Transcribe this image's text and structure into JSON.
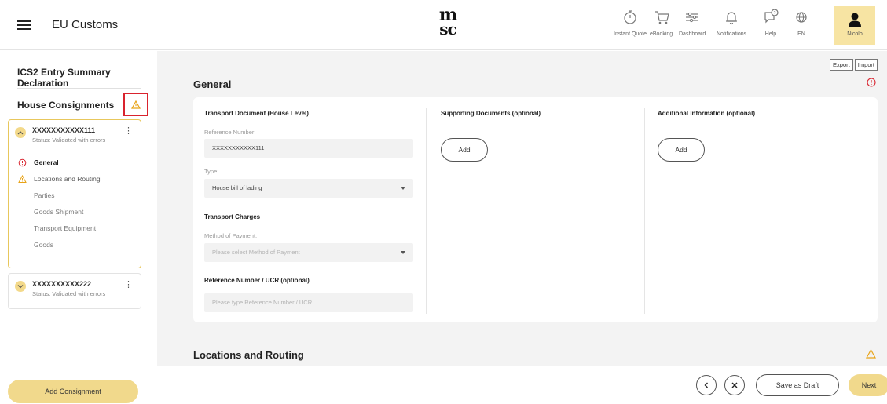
{
  "header": {
    "app_title": "EU Customs",
    "logo_line1": "m",
    "logo_line2": "sc",
    "nav": [
      {
        "label": "Instant Quote",
        "icon": "stopwatch-icon"
      },
      {
        "label": "eBooking",
        "icon": "cart-icon"
      },
      {
        "label": "Dashboard",
        "icon": "sliders-icon"
      },
      {
        "label": "Notifications",
        "icon": "bell-icon"
      },
      {
        "label": "Help",
        "icon": "help-chat-icon"
      },
      {
        "label": "EN",
        "icon": "globe-icon"
      }
    ],
    "user_label": "Nicolo"
  },
  "sidebar": {
    "title": "ICS2 Entry Summary Declaration",
    "subtitle": "House Consignments",
    "consignments": [
      {
        "id": "XXXXXXXXXXX111",
        "status": "Status: Validated with errors",
        "expanded": true,
        "sections": [
          {
            "label": "General",
            "state": "error"
          },
          {
            "label": "Locations and Routing",
            "state": "warning"
          },
          {
            "label": "Parties",
            "state": "none"
          },
          {
            "label": "Goods Shipment",
            "state": "none"
          },
          {
            "label": "Transport Equipment",
            "state": "none"
          },
          {
            "label": "Goods",
            "state": "none"
          }
        ]
      },
      {
        "id": "XXXXXXXXXX222",
        "status": "Status: Validated with errors",
        "expanded": false
      }
    ],
    "add_button": "Add Consignment"
  },
  "main": {
    "export_label": "Export",
    "import_label": "Import",
    "general_title": "General",
    "transport_doc": {
      "title": "Transport Document (House Level)",
      "ref_label": "Reference Number:",
      "ref_value": "XXXXXXXXXXX111",
      "type_label": "Type:",
      "type_value": "House bill of lading"
    },
    "transport_charges": {
      "title": "Transport Charges",
      "method_label": "Method of Payment:",
      "method_placeholder": "Please select Method of Payment"
    },
    "ucr": {
      "title": "Reference Number / UCR (optional)",
      "placeholder": "Please type Reference Number / UCR"
    },
    "supporting_docs": {
      "title": "Supporting Documents (optional)",
      "add_label": "Add"
    },
    "additional_info": {
      "title": "Additional Information (optional)",
      "add_label": "Add"
    },
    "locations_title": "Locations and Routing"
  },
  "footer": {
    "save_draft": "Save as Draft",
    "next": "Next"
  },
  "colors": {
    "accent": "#f1d98c",
    "error": "#d9232e",
    "warning": "#e8a317"
  }
}
